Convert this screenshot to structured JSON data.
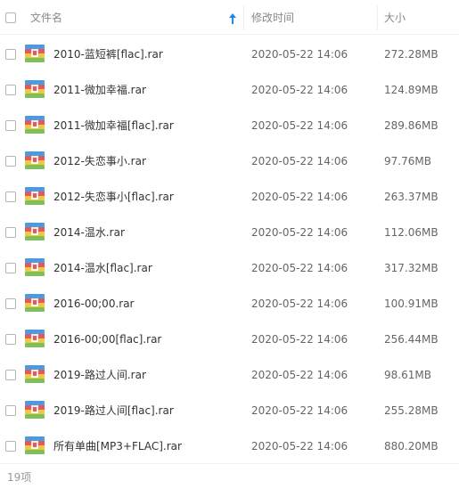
{
  "header": {
    "name_label": "文件名",
    "time_label": "修改时间",
    "size_label": "大小",
    "sort_icon": "arrow-up-icon"
  },
  "colors": {
    "sort_arrow": "#1e88e5",
    "icon_red": "#e45a5a",
    "icon_yellow": "#f3c64a",
    "icon_green": "#7bc25a",
    "icon_blue": "#4b9be0"
  },
  "files": [
    {
      "name": "2010-蓝短裤[flac].rar",
      "time": "2020-05-22 14:06",
      "size": "272.28MB",
      "icon": "rar-archive-icon"
    },
    {
      "name": "2011-微加幸福.rar",
      "time": "2020-05-22 14:06",
      "size": "124.89MB",
      "icon": "rar-archive-icon"
    },
    {
      "name": "2011-微加幸福[flac].rar",
      "time": "2020-05-22 14:06",
      "size": "289.86MB",
      "icon": "rar-archive-icon"
    },
    {
      "name": "2012-失恋事小.rar",
      "time": "2020-05-22 14:06",
      "size": "97.76MB",
      "icon": "rar-archive-icon"
    },
    {
      "name": "2012-失恋事小[flac].rar",
      "time": "2020-05-22 14:06",
      "size": "263.37MB",
      "icon": "rar-archive-icon"
    },
    {
      "name": "2014-温水.rar",
      "time": "2020-05-22 14:06",
      "size": "112.06MB",
      "icon": "rar-archive-icon"
    },
    {
      "name": "2014-温水[flac].rar",
      "time": "2020-05-22 14:06",
      "size": "317.32MB",
      "icon": "rar-archive-icon"
    },
    {
      "name": "2016-00;00.rar",
      "time": "2020-05-22 14:06",
      "size": "100.91MB",
      "icon": "rar-archive-icon"
    },
    {
      "name": "2016-00;00[flac].rar",
      "time": "2020-05-22 14:06",
      "size": "256.44MB",
      "icon": "rar-archive-icon"
    },
    {
      "name": "2019-路过人间.rar",
      "time": "2020-05-22 14:06",
      "size": "98.61MB",
      "icon": "rar-archive-icon"
    },
    {
      "name": "2019-路过人间[flac].rar",
      "time": "2020-05-22 14:06",
      "size": "255.28MB",
      "icon": "rar-archive-icon"
    },
    {
      "name": "所有单曲[MP3+FLAC].rar",
      "time": "2020-05-22 14:06",
      "size": "880.20MB",
      "icon": "rar-archive-icon"
    }
  ],
  "footer": {
    "count_label": "19项"
  }
}
